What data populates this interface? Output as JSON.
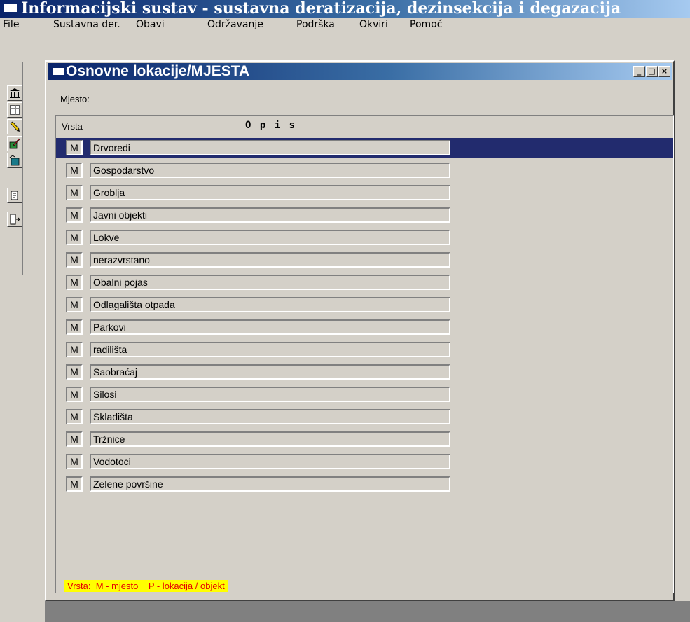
{
  "app": {
    "title": "Informacijski sustav - sustavna deratizacija, dezinsekcija i degazacija"
  },
  "menu": [
    "File",
    "Sustavna der.",
    "Obavi",
    "Održavanje",
    "Podrška",
    "Okviri",
    "Pomoć"
  ],
  "toolbar": {
    "icons": [
      "building-icon",
      "grid-icon",
      "pencil-icon",
      "edit-icon",
      "box-icon",
      "report-icon",
      "exit-door-icon"
    ]
  },
  "window": {
    "title": "Osnovne lokacije/MJESTA",
    "buttons": {
      "minimize": "_",
      "maximize": "□",
      "close": "×"
    },
    "mjesto_label": "Mjesto:",
    "columns": {
      "vrsta": "Vrsta",
      "opis": "O p i s"
    },
    "rows": [
      {
        "vrsta": "M",
        "opis": "Drvoredi",
        "selected": true
      },
      {
        "vrsta": "M",
        "opis": "Gospodarstvo"
      },
      {
        "vrsta": "M",
        "opis": "Groblja"
      },
      {
        "vrsta": "M",
        "opis": "Javni objekti"
      },
      {
        "vrsta": "M",
        "opis": "Lokve"
      },
      {
        "vrsta": "M",
        "opis": "nerazvrstano"
      },
      {
        "vrsta": "M",
        "opis": "Obalni pojas"
      },
      {
        "vrsta": "M",
        "opis": "Odlagališta otpada"
      },
      {
        "vrsta": "M",
        "opis": "Parkovi"
      },
      {
        "vrsta": "M",
        "opis": "radilišta"
      },
      {
        "vrsta": "M",
        "opis": "Saobraćaj"
      },
      {
        "vrsta": "M",
        "opis": "Silosi"
      },
      {
        "vrsta": "M",
        "opis": "Skladišta"
      },
      {
        "vrsta": "M",
        "opis": "Tržnice"
      },
      {
        "vrsta": "M",
        "opis": "Vodotoci"
      },
      {
        "vrsta": "M",
        "opis": "Zelene površine"
      }
    ],
    "legend": "Vrsta:  M - mjesto    P - lokacija / objekt"
  },
  "colors": {
    "selection": "#222b6e",
    "legend_bg": "#ffff00",
    "legend_text": "#e60000"
  }
}
